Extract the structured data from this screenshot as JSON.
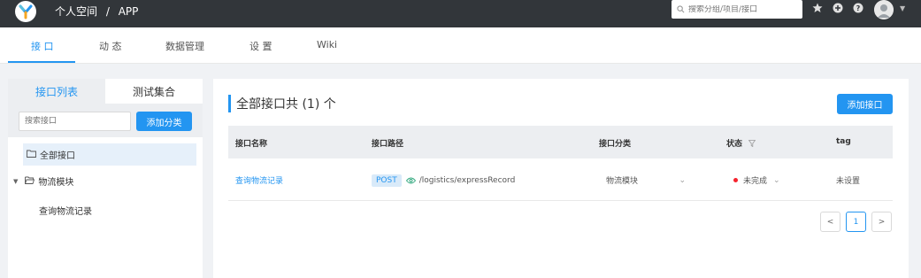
{
  "header": {
    "breadcrumb": [
      "个人空间",
      "APP"
    ],
    "breadcrumb_separator": "/",
    "search_placeholder": "搜索分组/项目/接口",
    "icons": [
      "logo-icon",
      "search-icon",
      "star-icon",
      "plus-circle-icon",
      "help-icon",
      "avatar",
      "chevron-down-icon"
    ]
  },
  "subnav": {
    "tabs": [
      {
        "label": "接 口",
        "active": true
      },
      {
        "label": "动 态",
        "active": false
      },
      {
        "label": "数据管理",
        "active": false
      },
      {
        "label": "设 置",
        "active": false
      },
      {
        "label": "Wiki",
        "active": false
      }
    ]
  },
  "left_panel": {
    "tabs": [
      {
        "label": "接口列表",
        "active": true
      },
      {
        "label": "测试集合",
        "active": false
      }
    ],
    "search_placeholder": "搜索接口",
    "add_category_label": "添加分类",
    "tree": {
      "all_label": "全部接口",
      "categories": [
        {
          "label": "物流模块",
          "expanded": true,
          "children": [
            "查询物流记录"
          ]
        }
      ]
    }
  },
  "main": {
    "title": "全部接口共 (1) 个",
    "add_button_label": "添加接口",
    "columns": [
      "接口名称",
      "接口路径",
      "接口分类",
      "状态",
      "tag"
    ],
    "rows": [
      {
        "name": "查询物流记录",
        "method": "POST",
        "path": "/logistics/expressRecord",
        "category": "物流模块",
        "status": "未完成",
        "tag": "未设置"
      }
    ],
    "pagination": {
      "prev": "<",
      "current": "1",
      "next": ">"
    }
  },
  "colors": {
    "topbar": "#32363a",
    "accent": "#2395f1",
    "status_incomplete": "#f5222d"
  }
}
